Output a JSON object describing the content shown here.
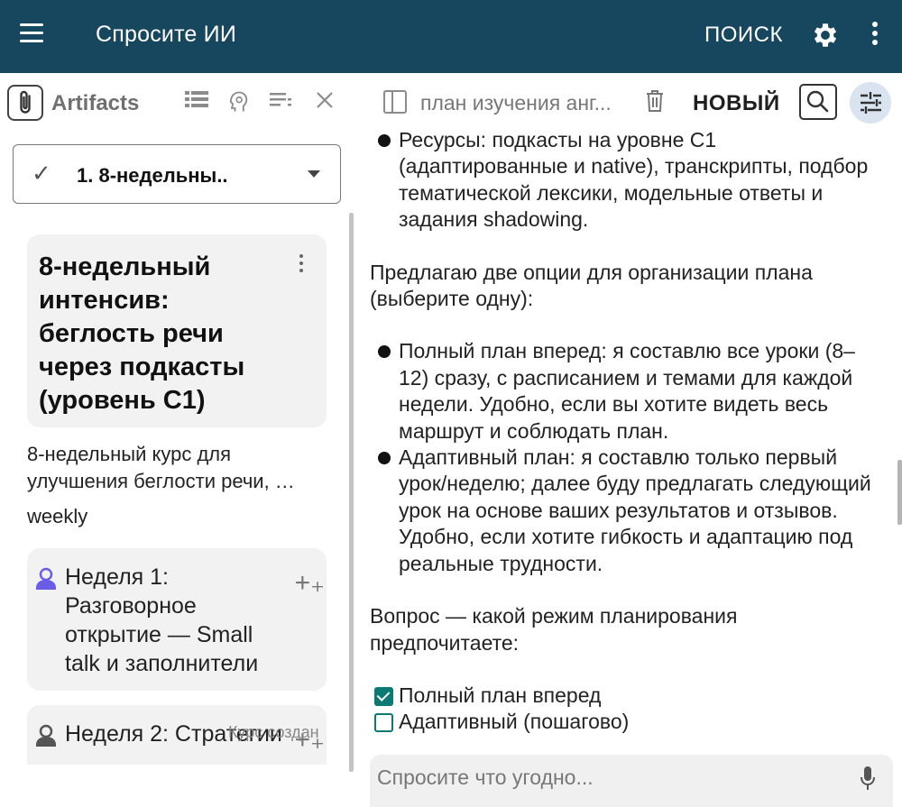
{
  "appbar": {
    "title": "Спросите ИИ",
    "search_label": "ПОИСК",
    "icons": [
      "menu-icon",
      "gear-icon",
      "more-vert-icon"
    ]
  },
  "left_panel": {
    "header_label": "Artifacts",
    "icons": [
      "paperclip-icon",
      "list-icon",
      "brain-icon",
      "notes-icon",
      "close-icon"
    ],
    "selected_artifact": "1. 8-недельны..",
    "title_card": {
      "title": "8-недельный интенсив: беглость речи через подкасты (уровень C1)"
    },
    "description": "8-недельный курс для улучшения беглости речи, …",
    "frequency": "weekly",
    "weeks": [
      {
        "label": "Неделя 1: Разговорное открытие — Small talk и заполнители",
        "icon_color": "#6b5ce7"
      },
      {
        "label": "Неделя 2: Стратегии",
        "icon_color": "#555555"
      }
    ],
    "footer_note": "Курс создан"
  },
  "right_panel": {
    "conversation_title": "план изучения анг...",
    "new_label": "НОВЫЙ",
    "icons": [
      "sidebar-toggle-icon",
      "trash-icon",
      "search-icon",
      "tune-icon"
    ],
    "messages": {
      "resources_bullet": "Ресурсы: подкасты на уровне C1 (адаптированные и native), транскрипты, подбор тематической лексики, модельные ответы и задания shadowing.",
      "intro": "Предлагаю две опции для организации плана (выберите одну):",
      "option_full": "Полный план вперед: я составлю все уроки (8–12) сразу, с расписанием и темами для каждой недели. Удобно, если вы хотите видеть весь маршрут и соблюдать план.",
      "option_adaptive": "Адаптивный план: я составлю только первый урок/неделю; далее буду предлагать следующий урок на основе ваших результатов и отзывов. Удобно, если хотите гибкость и адаптацию под реальные трудности.",
      "question": "Вопрос — какой режим планирования предпочитаете:",
      "choice_full": "Полный план вперед",
      "choice_adaptive": "Адаптивный (пошагово)"
    },
    "input_placeholder": "Спросите что угодно...",
    "accent_color": "#0a7a72"
  },
  "colors": {
    "appbar_bg": "#17475e",
    "card_bg": "#f2f2f2",
    "tune_bg": "#d9e4f0"
  }
}
